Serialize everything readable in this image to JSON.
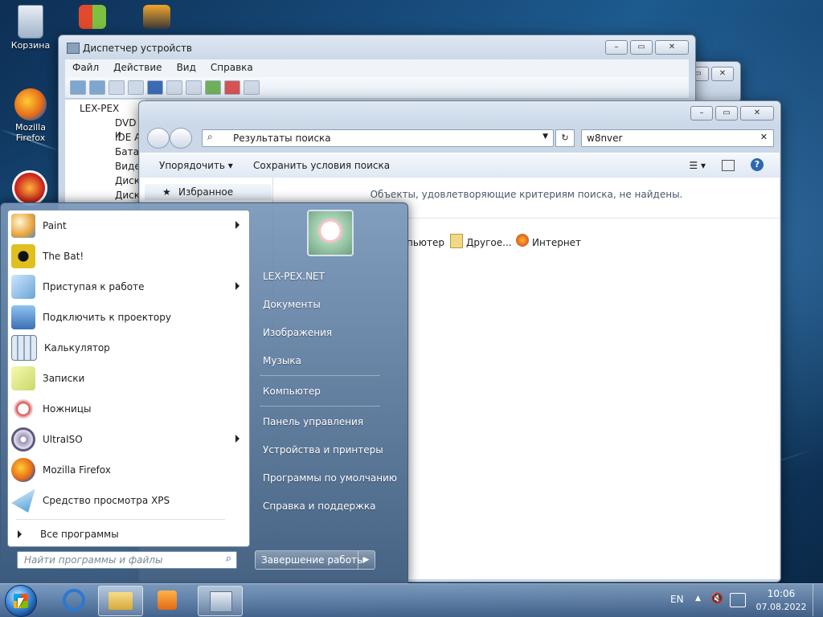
{
  "desktop": {
    "icons": [
      {
        "label": "Корзина"
      },
      {
        "label": "Mozilla Firefox"
      }
    ]
  },
  "device_manager": {
    "title": "Диспетчер устройств",
    "menu": [
      "Файл",
      "Действие",
      "Вид",
      "Справка"
    ],
    "tree_root": "LEX-PEX",
    "tree_items": [
      "DVD и",
      "IDE A",
      "Батар",
      "Видео",
      "Диско",
      "Диско"
    ]
  },
  "explorer": {
    "address": "Результаты поиска",
    "search_value": "w8nver",
    "organize_label": "Упорядочить",
    "save_search_label": "Сохранить условия поиска",
    "favorites_label": "Избранное",
    "no_results": "Объекты, удовлетворяющие критериям поиска, не найдены.",
    "search_again": [
      "пьютер",
      "Другое...",
      "Интернет"
    ]
  },
  "start_menu": {
    "programs": [
      {
        "label": "Paint",
        "submenu": true,
        "color": "#e8a33a"
      },
      {
        "label": "The Bat!",
        "submenu": false,
        "color": "#e0c020"
      },
      {
        "label": "Приступая к работе",
        "submenu": true,
        "color": "#6aa3d5"
      },
      {
        "label": "Подключить к проектору",
        "submenu": false,
        "color": "#3a6fb5"
      },
      {
        "label": "Калькулятор",
        "submenu": false,
        "color": "#8fa6c0"
      },
      {
        "label": "Записки",
        "submenu": false,
        "color": "#c9d86a"
      },
      {
        "label": "Ножницы",
        "submenu": false,
        "color": "#d64b4b"
      },
      {
        "label": "UltraISO",
        "submenu": true,
        "color": "#9a8fb6"
      },
      {
        "label": "Mozilla Firefox",
        "submenu": false,
        "color": "#e66a1a"
      },
      {
        "label": "Средство просмотра XPS",
        "submenu": false,
        "color": "#4a9ad6"
      }
    ],
    "all_programs": "Все программы",
    "search_placeholder": "Найти программы и файлы",
    "right_items": [
      "LEX-PEX.NET",
      "Документы",
      "Изображения",
      "Музыка",
      "Компьютер",
      "Панель управления",
      "Устройства и принтеры",
      "Программы по умолчанию",
      "Справка и поддержка"
    ],
    "shutdown_label": "Завершение работы"
  },
  "taskbar": {
    "language": "EN",
    "time": "10:06",
    "date": "07.08.2022"
  }
}
